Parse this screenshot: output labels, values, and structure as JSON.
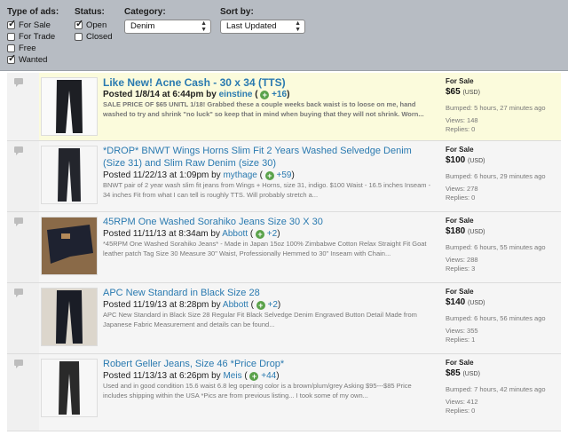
{
  "filters": {
    "type": {
      "heading": "Type of ads:",
      "options": [
        {
          "label": "For Sale",
          "checked": true
        },
        {
          "label": "For Trade",
          "checked": false
        },
        {
          "label": "Free",
          "checked": false
        },
        {
          "label": "Wanted",
          "checked": true
        }
      ]
    },
    "status": {
      "heading": "Status:",
      "options": [
        {
          "label": "Open",
          "checked": true
        },
        {
          "label": "Closed",
          "checked": false
        }
      ]
    },
    "category": {
      "heading": "Category:",
      "value": "Denim"
    },
    "sort": {
      "heading": "Sort by:",
      "value": "Last Updated"
    }
  },
  "listings": [
    {
      "title": "Like New! Acne Cash - 30 x 34 (TTS)",
      "posted_prefix": "Posted 1/8/14 at 6:44pm by",
      "user": "einstine",
      "score": "+16",
      "desc": "SALE PRICE OF $65 UNITL 1/18! Grabbed these a couple weeks back waist is to loose on me, hand washed to try and shrink \"no luck\" so keep that in mind when buying that they will not shrink. Worn...",
      "type": "For Sale",
      "price": "$65",
      "currency": "(USD)",
      "bumped": "Bumped: 5 hours, 27 minutes ago",
      "views": "Views: 148",
      "replies": "Replies: 0"
    },
    {
      "title": "*DROP* BNWT Wings Horns Slim Fit 2 Years Washed Selvedge Denim (Size 31) and Slim Raw Denim (size 30)",
      "posted_prefix": "Posted 11/22/13 at 1:09pm by",
      "user": "mythage",
      "score": "+59",
      "desc": "BNWT pair of 2 year wash slim fit jeans from Wings + Horns, size 31, indigo. $100  Waist - 16.5 inches Inseam - 34 inches   Fit from what I can tell is roughly TTS. Will probably stretch a...",
      "type": "For Sale",
      "price": "$100",
      "currency": "(USD)",
      "bumped": "Bumped: 6 hours, 29 minutes ago",
      "views": "Views: 278",
      "replies": "Replies: 0"
    },
    {
      "title": "45RPM One Washed Sorahiko Jeans Size 30 X 30",
      "posted_prefix": "Posted 11/11/13 at 8:34am by",
      "user": "Abbott",
      "score": "+2",
      "desc": "*45RPM One Washed Sorahiko Jeans* - Made in Japan 15oz 100% Zimbabwe Cotton Relax Straight Fit Goat leather patch Tag Size 30 Measure 30\" Waist, Professionally Hemmed to 30\" Inseam with Chain...",
      "type": "For Sale",
      "price": "$180",
      "currency": "(USD)",
      "bumped": "Bumped: 6 hours, 55 minutes ago",
      "views": "Views: 288",
      "replies": "Replies: 3"
    },
    {
      "title": "APC New Standard in Black Size 28",
      "posted_prefix": "Posted 11/19/13 at 8:28pm by",
      "user": "Abbott",
      "score": "+2",
      "desc": "APC New Standard in Black Size 28 Regular Fit Black Selvedge Denim Engraved Button Detail Made from Japanese Fabric Measurement and details can be found...",
      "type": "For Sale",
      "price": "$140",
      "currency": "(USD)",
      "bumped": "Bumped: 6 hours, 56 minutes ago",
      "views": "Views: 355",
      "replies": "Replies: 1"
    },
    {
      "title": "Robert Geller Jeans, Size 46 *Price Drop*",
      "posted_prefix": "Posted 11/13/13 at 6:26pm by",
      "user": "Meis",
      "score": "+44",
      "desc": "Used and in good condition 15.6 waist 6.8 leg opening color is a brown/plum/grey Asking $95---$85 Price includes shipping within the USA *Pics are from previous listing... I took some of my own...",
      "type": "For Sale",
      "price": "$85",
      "currency": "(USD)",
      "bumped": "Bumped: 7 hours, 42 minutes ago",
      "views": "Views: 412",
      "replies": "Replies: 0"
    }
  ]
}
